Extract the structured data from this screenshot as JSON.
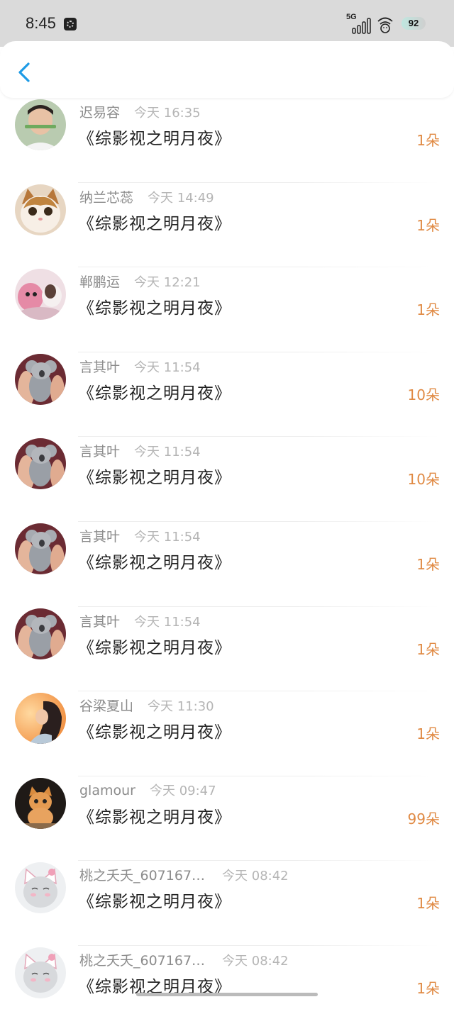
{
  "status_bar": {
    "time": "8:45",
    "network": "5G",
    "battery": "92",
    "icons": [
      "gallery-notification-icon",
      "signal-icon",
      "wifi-icon",
      "battery-icon"
    ]
  },
  "nav": {
    "back_icon": "chevron-left-icon"
  },
  "colors": {
    "accent": "#1e9be6",
    "count": "#e08a44",
    "name": "#8c8c8c",
    "time": "#b5b5b5"
  },
  "items": [
    {
      "name": "迟易容",
      "time": "今天 16:35",
      "title": "《综影视之明月夜》",
      "count": "1朵",
      "avatar": "man-avatar"
    },
    {
      "name": "纳兰芯蕊",
      "time": "今天 14:49",
      "title": "《综影视之明月夜》",
      "count": "1朵",
      "avatar": "cat-avatar"
    },
    {
      "name": "郸鹏运",
      "time": "今天 12:21",
      "title": "《综影视之明月夜》",
      "count": "1朵",
      "avatar": "pink-toy-avatar"
    },
    {
      "name": "言其叶",
      "time": "今天 11:54",
      "title": "《综影视之明月夜》",
      "count": "10朵",
      "avatar": "koala-avatar"
    },
    {
      "name": "言其叶",
      "time": "今天 11:54",
      "title": "《综影视之明月夜》",
      "count": "10朵",
      "avatar": "koala-avatar"
    },
    {
      "name": "言其叶",
      "time": "今天 11:54",
      "title": "《综影视之明月夜》",
      "count": "1朵",
      "avatar": "koala-avatar"
    },
    {
      "name": "言其叶",
      "time": "今天 11:54",
      "title": "《综影视之明月夜》",
      "count": "1朵",
      "avatar": "koala-avatar"
    },
    {
      "name": "谷梁夏山",
      "time": "今天 11:30",
      "title": "《综影视之明月夜》",
      "count": "1朵",
      "avatar": "girl-avatar"
    },
    {
      "name": "glamour",
      "time": "今天 09:47",
      "title": "《综影视之明月夜》",
      "count": "99朵",
      "avatar": "kitten-avatar"
    },
    {
      "name": "桃之夭夭_607167…",
      "time": "今天 08:42",
      "title": "《综影视之明月夜》",
      "count": "1朵",
      "avatar": "cartoon-cat-avatar"
    },
    {
      "name": "桃之夭夭_607167…",
      "time": "今天 08:42",
      "title": "《综影视之明月夜》",
      "count": "1朵",
      "avatar": "cartoon-cat-avatar"
    }
  ]
}
